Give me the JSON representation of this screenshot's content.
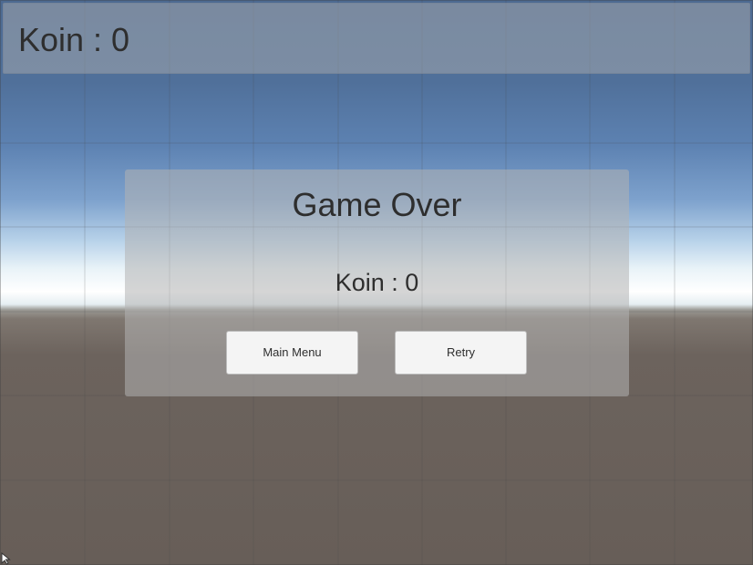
{
  "hud": {
    "coin_text": "Koin : 0"
  },
  "game_over_panel": {
    "title": "Game Over",
    "coin_text": "Koin : 0",
    "buttons": {
      "main_menu_label": "Main Menu",
      "retry_label": "Retry"
    }
  },
  "colors": {
    "text": "#2e2e2e",
    "button_bg": "#f4f4f4",
    "panel_overlay": "rgba(178,178,178,0.55)",
    "sky_top": "#4d6a92",
    "horizon": "#ffffff",
    "ground": "#675e58",
    "grid_line": "rgba(80,80,80,0.25)"
  },
  "icons": {
    "cursor": "mouse-pointer-icon"
  }
}
